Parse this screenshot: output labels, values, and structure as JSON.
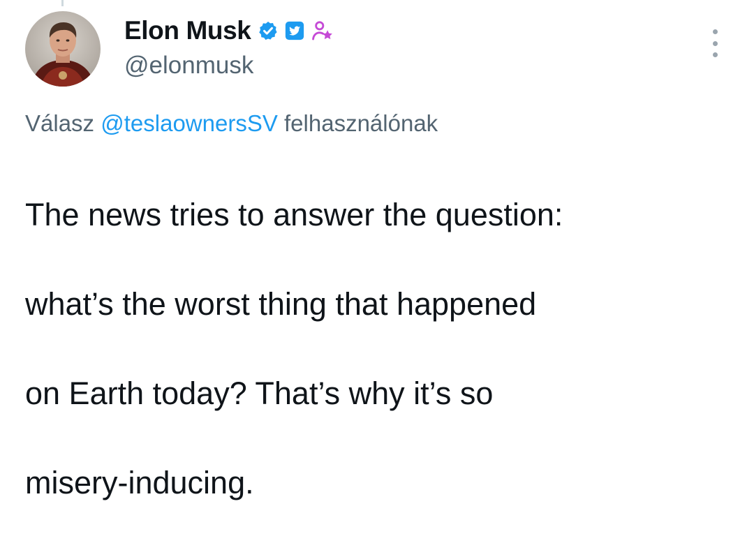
{
  "tweet": {
    "author": {
      "display_name": "Elon Musk",
      "handle": "@elonmusk",
      "badges": [
        {
          "icon": "verified-badge-icon",
          "color": "#1d9bf0"
        },
        {
          "icon": "twitter-bird-square-icon",
          "color": "#1d9bf0"
        },
        {
          "icon": "user-star-icon",
          "color": "#c54ad6"
        }
      ]
    },
    "reply_context": {
      "prefix": "Válasz",
      "mention": "@teslaownersSV",
      "suffix": "felhasználónak"
    },
    "text_lines": [
      "The news tries to answer the question:",
      "what’s the worst thing that happened",
      "on Earth today? That’s why it’s so",
      "misery-inducing."
    ]
  },
  "colors": {
    "text_primary": "#0f1419",
    "text_secondary": "#536471",
    "link": "#1d9bf0",
    "verified": "#1d9bf0"
  }
}
